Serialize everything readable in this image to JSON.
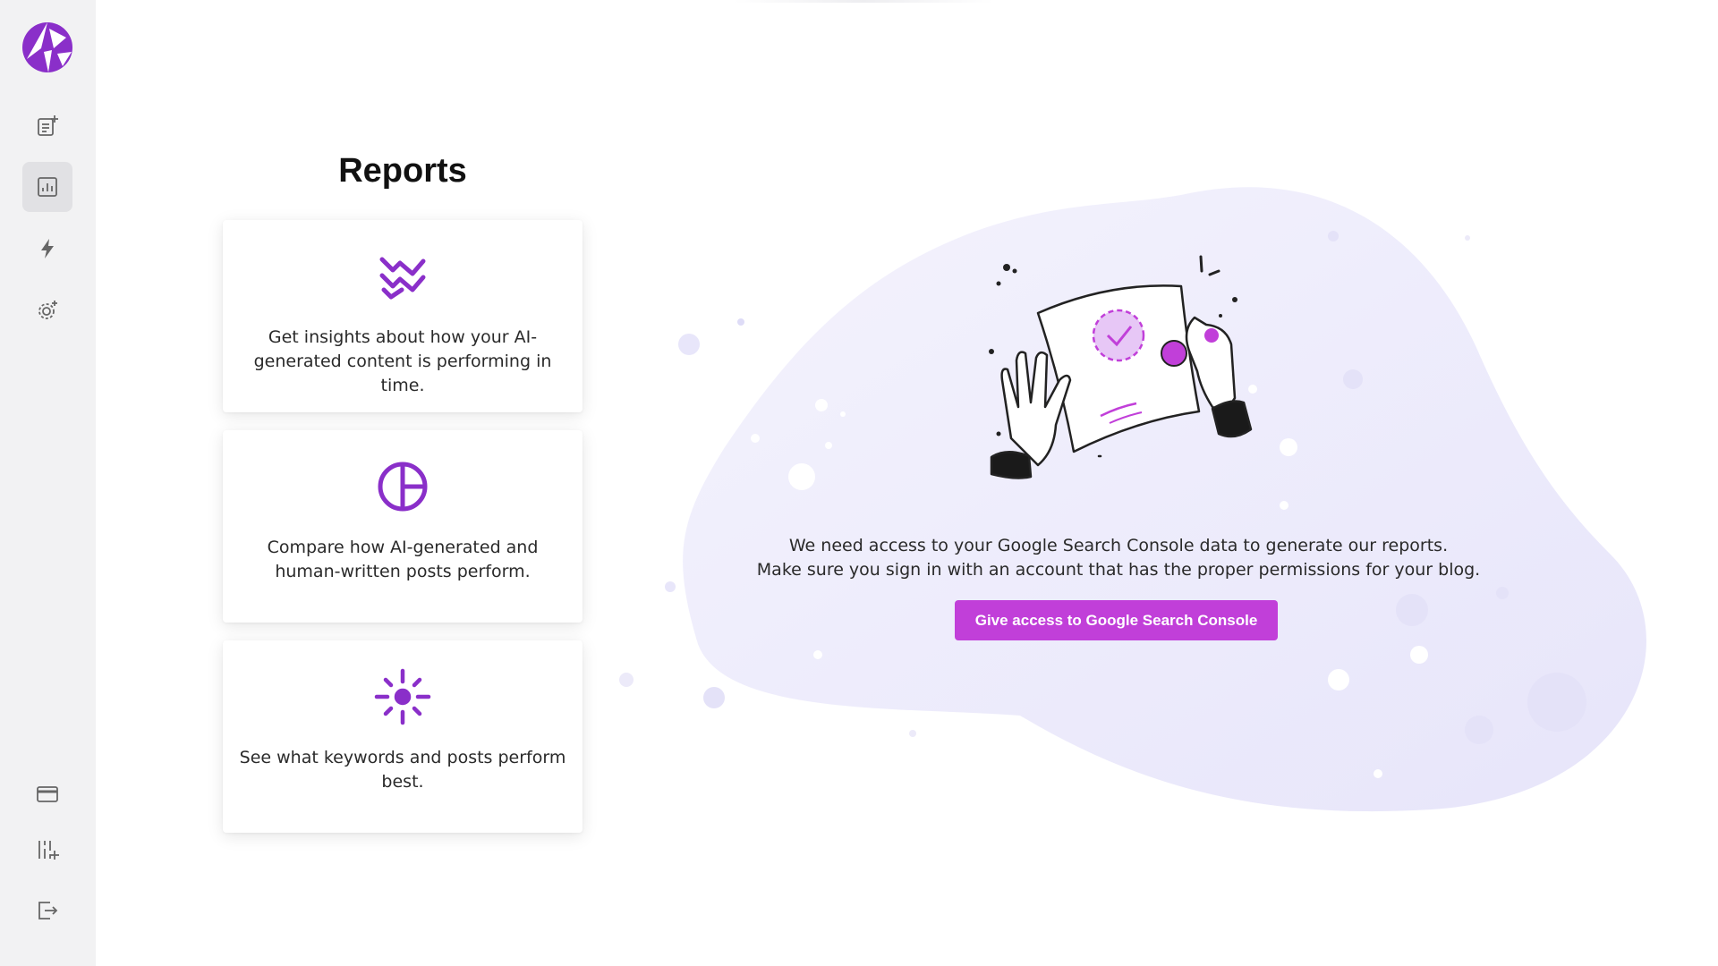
{
  "app": {
    "brand_color": "#8a2fc9",
    "accent_color": "#c13fd9"
  },
  "sidebar": {
    "top_items": [
      {
        "icon": "new-article-icon",
        "active": false
      },
      {
        "icon": "reports-icon",
        "active": true
      },
      {
        "icon": "lightning-icon",
        "active": false
      },
      {
        "icon": "settings-gear-icon",
        "active": false
      }
    ],
    "bottom_items": [
      {
        "icon": "credit-card-icon"
      },
      {
        "icon": "sliders-add-icon"
      },
      {
        "icon": "logout-icon"
      }
    ]
  },
  "main": {
    "title": "Reports",
    "cards": [
      {
        "icon": "trend-lines-icon",
        "text": "Get insights about how your AI-generated content is performing in time."
      },
      {
        "icon": "pie-chart-icon",
        "text": "Compare how AI-generated and human-written posts perform."
      },
      {
        "icon": "sparkle-target-icon",
        "text": "See what keywords and posts perform best."
      }
    ],
    "message_line1": "We need access to your Google Search Console data to generate our reports.",
    "message_line2": "Make sure you sign in with an account that has the proper permissions for your blog.",
    "gsc_button_label": "Give access to Google Search Console"
  }
}
